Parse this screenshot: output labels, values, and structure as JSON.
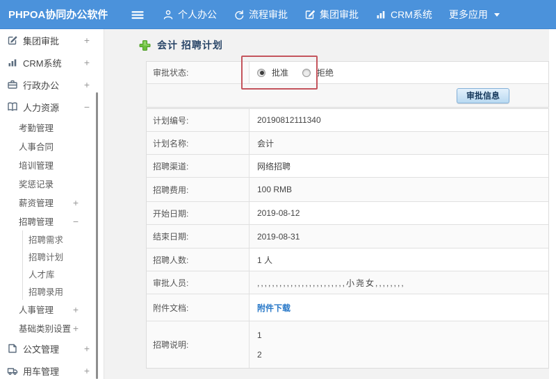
{
  "topbar": {
    "logo": "PHPOA协同办公软件",
    "items": [
      {
        "name": "personal-office",
        "label": "个人办公",
        "icon": "user-icon"
      },
      {
        "name": "flow-approval",
        "label": "流程审批",
        "icon": "flow-icon"
      },
      {
        "name": "group-approval",
        "label": "集团审批",
        "icon": "edit-icon"
      },
      {
        "name": "crm-system",
        "label": "CRM系统",
        "icon": "chart-icon"
      },
      {
        "name": "more-apps",
        "label": "更多应用",
        "icon": "",
        "caret": true
      }
    ]
  },
  "sidebar": {
    "items": [
      {
        "name": "group-approval",
        "label": "集团审批",
        "level": 1,
        "icon": "edit-square-icon",
        "expand": "+"
      },
      {
        "name": "crm-system",
        "label": "CRM系统",
        "level": 1,
        "icon": "bar-chart-icon",
        "expand": "+"
      },
      {
        "name": "admin-office",
        "label": "行政办公",
        "level": 1,
        "icon": "briefcase-icon",
        "expand": "+"
      },
      {
        "name": "hr",
        "label": "人力资源",
        "level": 1,
        "icon": "book-icon",
        "expand": "−"
      },
      {
        "name": "attendance",
        "label": "考勤管理",
        "level": 2,
        "expand": ""
      },
      {
        "name": "hr-contract",
        "label": "人事合同",
        "level": 2,
        "expand": ""
      },
      {
        "name": "training",
        "label": "培训管理",
        "level": 2,
        "expand": ""
      },
      {
        "name": "reward-record",
        "label": "奖惩记录",
        "level": 2,
        "expand": ""
      },
      {
        "name": "salary",
        "label": "薪资管理",
        "level": 2,
        "expand": "+"
      },
      {
        "name": "recruit-mgmt",
        "label": "招聘管理",
        "level": 2,
        "expand": "−"
      },
      {
        "name": "recruit-need",
        "label": "招聘需求",
        "level": 3,
        "expand": ""
      },
      {
        "name": "recruit-plan",
        "label": "招聘计划",
        "level": 3,
        "expand": ""
      },
      {
        "name": "talent-pool",
        "label": "人才库",
        "level": 3,
        "expand": ""
      },
      {
        "name": "recruit-hire",
        "label": "招聘录用",
        "level": 3,
        "expand": ""
      },
      {
        "name": "personnel",
        "label": "人事管理",
        "level": 2,
        "expand": "+"
      },
      {
        "name": "base-category",
        "label": "基础类别设置",
        "level": 2,
        "expand": "+"
      },
      {
        "name": "doc-mgmt",
        "label": "公文管理",
        "level": 1,
        "icon": "document-icon",
        "expand": "+"
      },
      {
        "name": "vehicle-mgmt",
        "label": "用车管理",
        "level": 1,
        "icon": "car-icon",
        "expand": "+"
      }
    ]
  },
  "main": {
    "title": "会计 招聘计划",
    "approval": {
      "label": "审批状态:",
      "options": [
        {
          "label": "批准",
          "checked": true
        },
        {
          "label": "拒绝",
          "checked": false
        }
      ],
      "button": "审批信息"
    },
    "rows": [
      {
        "label": "计划编号:",
        "value": "20190812111340"
      },
      {
        "label": "计划名称:",
        "value": "会计"
      },
      {
        "label": "招聘渠道:",
        "value": "网络招聘"
      },
      {
        "label": "招聘费用:",
        "value": "100 RMB"
      },
      {
        "label": "开始日期:",
        "value": "2019-08-12"
      },
      {
        "label": "结束日期:",
        "value": "2019-08-31"
      },
      {
        "label": "招聘人数:",
        "value": "1 人"
      },
      {
        "label": "审批人员:",
        "value": ",,,,,,,,,,,,,,,,,,,,,,,,小尧女,,,,,,,,"
      },
      {
        "label": "附件文档:",
        "value": "附件下载",
        "type": "link"
      },
      {
        "label": "招聘说明:",
        "value": [
          "1",
          "2"
        ],
        "type": "multiline"
      }
    ]
  },
  "colors": {
    "topbar_blue": "#4b92db",
    "highlight_red": "#c4545c",
    "link_blue": "#2878c8",
    "button_border": "#83b0d8",
    "plus_green": "#6cbf3c",
    "title_navy": "#2a4668"
  }
}
